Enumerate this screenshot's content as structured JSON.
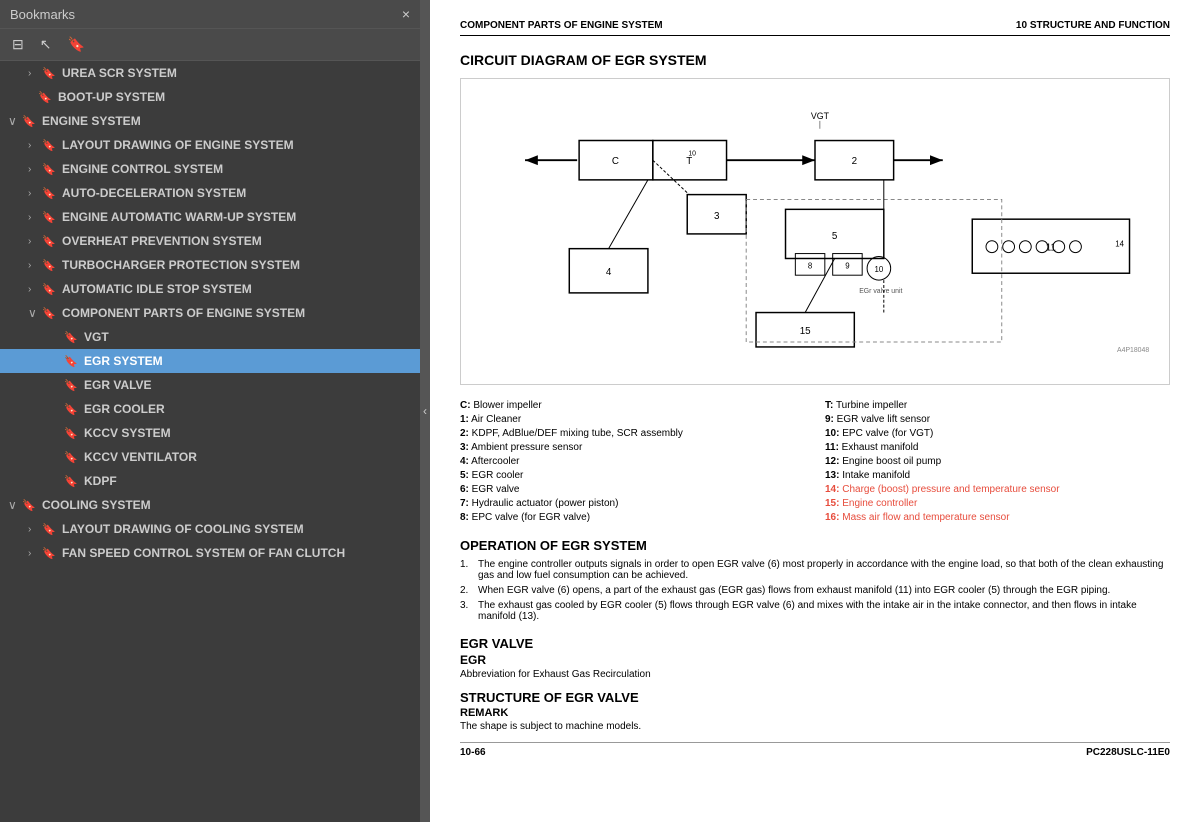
{
  "bookmarks": {
    "title": "Bookmarks",
    "close_label": "×",
    "toolbar_icons": [
      "collapse-icon",
      "cursor-icon",
      "bookmark-add-icon"
    ],
    "items": [
      {
        "id": "urea",
        "level": 1,
        "arrow": "›",
        "label": "UREA SCR SYSTEM",
        "expanded": false,
        "selected": false
      },
      {
        "id": "bootup",
        "level": 1,
        "arrow": "",
        "label": "BOOT-UP SYSTEM",
        "expanded": false,
        "selected": false
      },
      {
        "id": "engine",
        "level": 1,
        "arrow": "∨",
        "label": "ENGINE SYSTEM",
        "expanded": true,
        "selected": false
      },
      {
        "id": "layout-engine",
        "level": 2,
        "arrow": "›",
        "label": "LAYOUT DRAWING OF ENGINE SYSTEM",
        "expanded": false,
        "selected": false
      },
      {
        "id": "engine-control",
        "level": 2,
        "arrow": "›",
        "label": "ENGINE CONTROL SYSTEM",
        "expanded": false,
        "selected": false
      },
      {
        "id": "auto-decel",
        "level": 2,
        "arrow": "›",
        "label": "AUTO-DECELERATION SYSTEM",
        "expanded": false,
        "selected": false
      },
      {
        "id": "engine-warmup",
        "level": 2,
        "arrow": "›",
        "label": "ENGINE AUTOMATIC WARM-UP SYSTEM",
        "expanded": false,
        "selected": false
      },
      {
        "id": "overheat",
        "level": 2,
        "arrow": "›",
        "label": "OVERHEAT PREVENTION SYSTEM",
        "expanded": false,
        "selected": false
      },
      {
        "id": "turbo",
        "level": 2,
        "arrow": "›",
        "label": "TURBOCHARGER PROTECTION SYSTEM",
        "expanded": false,
        "selected": false
      },
      {
        "id": "idle-stop",
        "level": 2,
        "arrow": "›",
        "label": "AUTOMATIC IDLE STOP SYSTEM",
        "expanded": false,
        "selected": false
      },
      {
        "id": "comp-engine",
        "level": 2,
        "arrow": "∨",
        "label": "COMPONENT PARTS OF ENGINE SYSTEM",
        "expanded": true,
        "selected": false
      },
      {
        "id": "vgt",
        "level": 3,
        "arrow": "",
        "label": "VGT",
        "expanded": false,
        "selected": false
      },
      {
        "id": "egr-system",
        "level": 3,
        "arrow": "",
        "label": "EGR SYSTEM",
        "expanded": false,
        "selected": true
      },
      {
        "id": "egr-valve",
        "level": 3,
        "arrow": "",
        "label": "EGR VALVE",
        "expanded": false,
        "selected": false
      },
      {
        "id": "egr-cooler",
        "level": 3,
        "arrow": "",
        "label": "EGR COOLER",
        "expanded": false,
        "selected": false
      },
      {
        "id": "kccv",
        "level": 3,
        "arrow": "",
        "label": "KCCV SYSTEM",
        "expanded": false,
        "selected": false
      },
      {
        "id": "kccv-vent",
        "level": 3,
        "arrow": "",
        "label": "KCCV VENTILATOR",
        "expanded": false,
        "selected": false
      },
      {
        "id": "kdpf",
        "level": 3,
        "arrow": "",
        "label": "KDPF",
        "expanded": false,
        "selected": false
      },
      {
        "id": "cooling",
        "level": 1,
        "arrow": "∨",
        "label": "COOLING SYSTEM",
        "expanded": true,
        "selected": false
      },
      {
        "id": "layout-cooling",
        "level": 2,
        "arrow": "›",
        "label": "LAYOUT DRAWING OF COOLING SYSTEM",
        "expanded": false,
        "selected": false
      },
      {
        "id": "fan-speed",
        "level": 2,
        "arrow": "›",
        "label": "FAN SPEED CONTROL SYSTEM OF FAN CLUTCH",
        "expanded": false,
        "selected": false
      }
    ]
  },
  "content": {
    "header_left": "COMPONENT PARTS OF ENGINE SYSTEM",
    "header_right": "10 STRUCTURE AND FUNCTION",
    "diagram_title": "CIRCUIT DIAGRAM OF EGR SYSTEM",
    "diagram_footnote": "A4P18048",
    "legend": [
      {
        "key": "C:",
        "value": "Blower impeller",
        "col": 1
      },
      {
        "key": "T:",
        "value": "Turbine impeller",
        "col": 2
      },
      {
        "key": "1:",
        "value": "Air Cleaner",
        "col": 1
      },
      {
        "key": "9:",
        "value": "EGR valve lift sensor",
        "col": 2
      },
      {
        "key": "2:",
        "value": "KDPF, AdBlue/DEF mixing tube, SCR assembly",
        "col": 1
      },
      {
        "key": "10:",
        "value": "EPC valve (for VGT)",
        "col": 2
      },
      {
        "key": "3:",
        "value": "Ambient pressure sensor",
        "col": 1
      },
      {
        "key": "11:",
        "value": "Exhaust manifold",
        "col": 2
      },
      {
        "key": "4:",
        "value": "Aftercooler",
        "col": 1
      },
      {
        "key": "12:",
        "value": "Engine boost oil pump",
        "col": 2
      },
      {
        "key": "5:",
        "value": "EGR cooler",
        "col": 1
      },
      {
        "key": "13:",
        "value": "Intake manifold",
        "col": 2
      },
      {
        "key": "6:",
        "value": "EGR valve",
        "col": 1
      },
      {
        "key": "14:",
        "value": "Charge (boost) pressure and temperature sensor",
        "col": 2
      },
      {
        "key": "7:",
        "value": "Hydraulic actuator (power piston)",
        "col": 1
      },
      {
        "key": "15:",
        "value": "Engine controller",
        "col": 2
      },
      {
        "key": "8:",
        "value": "EPC valve (for EGR valve)",
        "col": 1
      },
      {
        "key": "16:",
        "value": "Mass air flow and temperature sensor",
        "col": 2
      }
    ],
    "operation_title": "OPERATION OF EGR SYSTEM",
    "operation_items": [
      "The engine controller outputs signals in order to open EGR valve (6) most properly in accordance with the engine load, so that both of the clean exhausting gas and low fuel consumption can be achieved.",
      "When EGR valve (6) opens, a part of the exhaust gas (EGR gas) flows from exhaust manifold (11) into EGR cooler (5) through the EGR piping.",
      "The exhaust gas cooled by EGR cooler (5) flows through EGR valve (6) and mixes with the intake air in the intake connector, and then flows in intake manifold (13)."
    ],
    "egr_valve_title": "EGR VALVE",
    "egr_abbrev": "EGR",
    "egr_abbrev_desc": "Abbreviation for Exhaust Gas Recirculation",
    "struct_title": "STRUCTURE OF EGR VALVE",
    "remark_label": "REMARK",
    "remark_text": "The shape is subject to machine models.",
    "footer_left": "10-66",
    "footer_right": "PC228USLC-11E0"
  }
}
